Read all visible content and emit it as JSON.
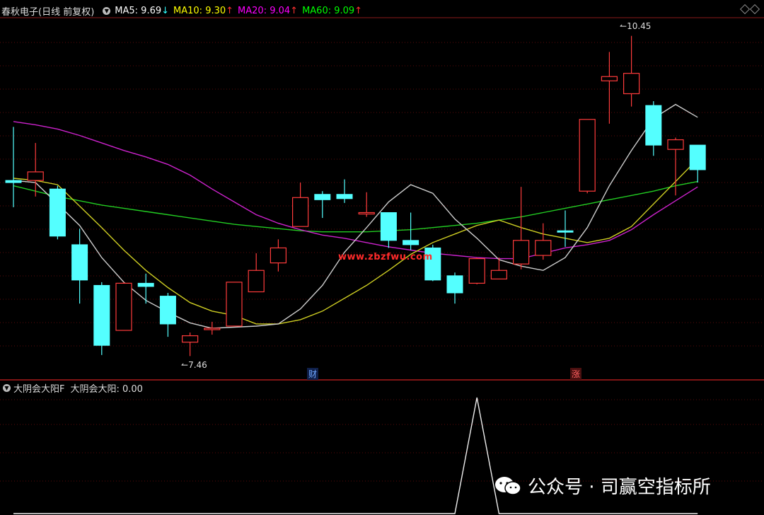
{
  "header": {
    "stock_title": "春秋电子(日线 前复权)",
    "ma5": {
      "label": "MA5: 9.69",
      "arrow": "↓",
      "color": "#ffffff"
    },
    "ma10": {
      "label": "MA10: 9.30",
      "arrow": "↑",
      "color": "#ffff00"
    },
    "ma20": {
      "label": "MA20: 9.04",
      "arrow": "↑",
      "color": "#ff00ff"
    },
    "ma60": {
      "label": "MA60: 9.09",
      "arrow": "↑",
      "color": "#00ff00"
    },
    "arrow_up_color": "#ff3030",
    "arrow_down_color": "#30ffff"
  },
  "annotations": {
    "high_label": "10.45",
    "low_label": "7.46",
    "tag_cai": "财",
    "tag_zhang": "涨"
  },
  "sub_panel": {
    "title": "大阴会大阳F",
    "value_label": "大阴会大阳: 0.00"
  },
  "watermarks": {
    "center": "www.zbzfwu.com",
    "bottom": "公众号 · 司赢空指标所"
  },
  "chart_data": {
    "type": "candlestick",
    "up_color": "#ff3b3b",
    "down_color": "#54ffff",
    "ylim": [
      7.35,
      10.6
    ],
    "candles": [
      {
        "o": 9.1,
        "c": 9.08,
        "h": 9.6,
        "l": 8.85
      },
      {
        "o": 9.1,
        "c": 9.18,
        "h": 9.45,
        "l": 8.95
      },
      {
        "o": 9.02,
        "c": 8.58,
        "h": 9.05,
        "l": 8.55
      },
      {
        "o": 8.5,
        "c": 8.17,
        "h": 8.65,
        "l": 7.95
      },
      {
        "o": 8.12,
        "c": 7.56,
        "h": 8.15,
        "l": 7.47
      },
      {
        "o": 7.7,
        "c": 8.14,
        "h": 8.15,
        "l": 7.7
      },
      {
        "o": 8.14,
        "c": 8.11,
        "h": 8.23,
        "l": 7.95
      },
      {
        "o": 8.02,
        "c": 7.76,
        "h": 8.05,
        "l": 7.64
      },
      {
        "o": 7.59,
        "c": 7.65,
        "h": 7.68,
        "l": 7.46
      },
      {
        "o": 7.72,
        "c": 7.72,
        "h": 7.78,
        "l": 7.66
      },
      {
        "o": 7.74,
        "c": 8.15,
        "h": 8.15,
        "l": 7.74
      },
      {
        "o": 8.06,
        "c": 8.26,
        "h": 8.42,
        "l": 8.06
      },
      {
        "o": 8.33,
        "c": 8.47,
        "h": 8.55,
        "l": 8.25
      },
      {
        "o": 8.67,
        "c": 8.94,
        "h": 9.08,
        "l": 8.67
      },
      {
        "o": 8.97,
        "c": 8.92,
        "h": 9.0,
        "l": 8.75
      },
      {
        "o": 8.97,
        "c": 8.93,
        "h": 9.11,
        "l": 8.89
      },
      {
        "o": 8.8,
        "c": 8.8,
        "h": 8.99,
        "l": 8.76
      },
      {
        "o": 8.8,
        "c": 8.54,
        "h": 8.8,
        "l": 8.47
      },
      {
        "o": 8.54,
        "c": 8.5,
        "h": 8.8,
        "l": 8.45
      },
      {
        "o": 8.47,
        "c": 8.17,
        "h": 8.5,
        "l": 8.16
      },
      {
        "o": 8.21,
        "c": 8.05,
        "h": 8.24,
        "l": 7.95
      },
      {
        "o": 8.14,
        "c": 8.37,
        "h": 8.38,
        "l": 8.13
      },
      {
        "o": 8.18,
        "c": 8.26,
        "h": 8.38,
        "l": 8.18
      },
      {
        "o": 8.32,
        "c": 8.54,
        "h": 9.04,
        "l": 8.27
      },
      {
        "o": 8.4,
        "c": 8.54,
        "h": 8.7,
        "l": 8.36
      },
      {
        "o": 8.63,
        "c": 8.62,
        "h": 8.82,
        "l": 8.48
      },
      {
        "o": 9.0,
        "c": 9.67,
        "h": 9.67,
        "l": 8.98
      },
      {
        "o": 10.03,
        "c": 10.07,
        "h": 10.3,
        "l": 9.63
      },
      {
        "o": 9.91,
        "c": 10.1,
        "h": 10.45,
        "l": 9.79
      },
      {
        "o": 9.8,
        "c": 9.43,
        "h": 9.84,
        "l": 9.33
      },
      {
        "o": 9.39,
        "c": 9.48,
        "h": 9.5,
        "l": 8.96
      },
      {
        "o": 9.43,
        "c": 9.2,
        "h": 9.43,
        "l": 9.08
      }
    ],
    "ma5": [
      9.1,
      9.08,
      8.88,
      8.68,
      8.38,
      8.15,
      7.98,
      7.87,
      7.77,
      7.72,
      7.73,
      7.74,
      7.76,
      7.9,
      8.12,
      8.43,
      8.66,
      8.9,
      9.06,
      8.98,
      8.74,
      8.56,
      8.36,
      8.3,
      8.26,
      8.38,
      8.66,
      9.05,
      9.38,
      9.68,
      9.81,
      9.69
    ],
    "ma10": [
      9.12,
      9.1,
      9.06,
      8.86,
      8.66,
      8.45,
      8.26,
      8.1,
      7.96,
      7.88,
      7.84,
      7.76,
      7.76,
      7.8,
      7.88,
      8.0,
      8.12,
      8.26,
      8.41,
      8.52,
      8.6,
      8.68,
      8.73,
      8.66,
      8.6,
      8.56,
      8.52,
      8.56,
      8.67,
      8.88,
      9.09,
      9.3
    ],
    "ma20": [
      9.65,
      9.62,
      9.58,
      9.52,
      9.45,
      9.38,
      9.32,
      9.25,
      9.15,
      9.02,
      8.9,
      8.78,
      8.7,
      8.64,
      8.59,
      8.56,
      8.52,
      8.48,
      8.45,
      8.42,
      8.4,
      8.38,
      8.37,
      8.37,
      8.42,
      8.47,
      8.5,
      8.54,
      8.64,
      8.78,
      8.91,
      9.04
    ],
    "ma60": [
      9.05,
      9.0,
      8.95,
      8.91,
      8.87,
      8.84,
      8.81,
      8.78,
      8.75,
      8.72,
      8.69,
      8.67,
      8.65,
      8.63,
      8.62,
      8.62,
      8.62,
      8.63,
      8.64,
      8.66,
      8.68,
      8.7,
      8.73,
      8.76,
      8.8,
      8.84,
      8.88,
      8.92,
      8.96,
      9.0,
      9.05,
      9.09
    ],
    "indicator": {
      "name": "大阴会大阳",
      "ylim": [
        0,
        1
      ],
      "values": [
        0,
        0,
        0,
        0,
        0,
        0,
        0,
        0,
        0,
        0,
        0,
        0,
        0,
        0,
        0,
        0,
        0,
        0,
        0,
        0,
        0,
        1,
        0,
        0,
        0,
        0,
        0,
        0,
        0,
        0,
        0,
        0
      ]
    }
  }
}
